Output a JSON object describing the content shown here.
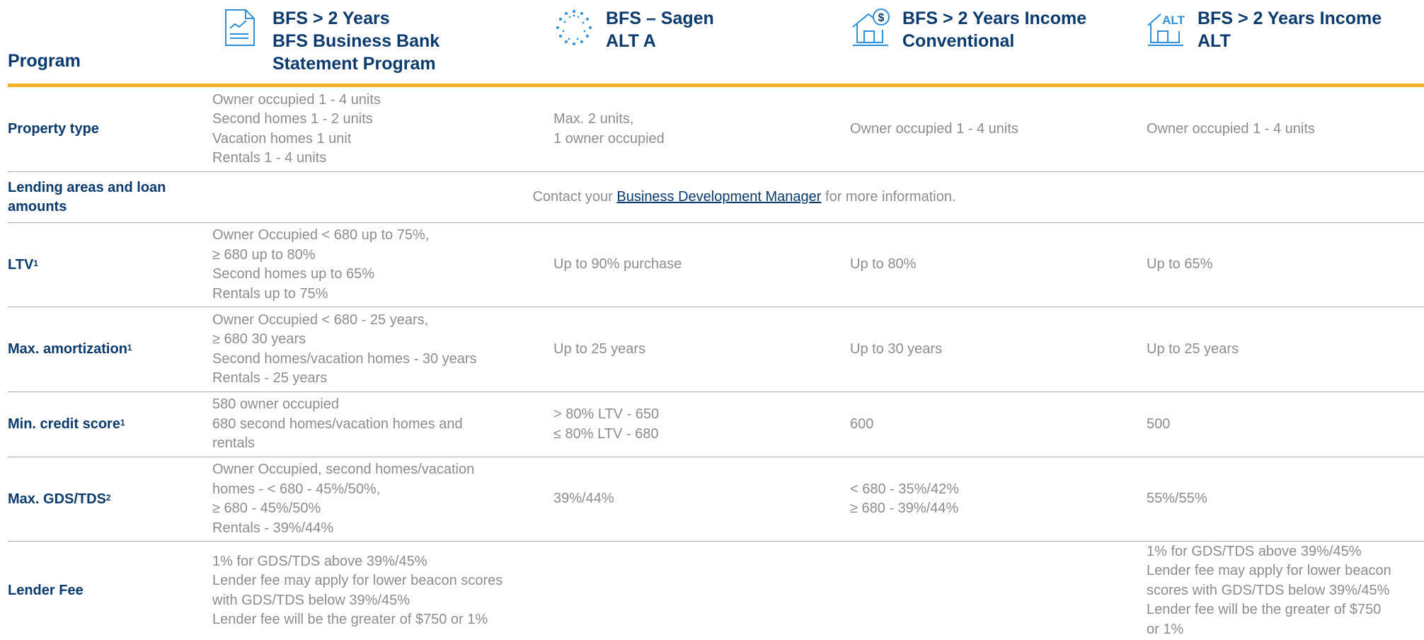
{
  "header": {
    "program_label": "Program",
    "columns": [
      {
        "icon": "bank-statement-icon",
        "title_lines": [
          "BFS > 2 Years",
          "BFS Business Bank",
          "Statement Program"
        ]
      },
      {
        "icon": "dotted-circle-logo-icon",
        "title_lines": [
          "BFS – Sagen",
          "ALT A"
        ]
      },
      {
        "icon": "house-dollar-icon",
        "title_lines": [
          "BFS > 2 Years Income",
          "Conventional"
        ]
      },
      {
        "icon": "house-alt-icon",
        "icon_text": "ALT",
        "title_lines": [
          "BFS > 2 Years Income",
          "ALT"
        ]
      }
    ]
  },
  "colors": {
    "navy": "#0b3a6e",
    "gold": "#f2b023",
    "text": "#8a8d91",
    "rule": "#a9acaf",
    "icon_blue": "#2f8fd8"
  },
  "rows": [
    {
      "label": "Property type",
      "sup": "",
      "cells": [
        [
          "Owner occupied 1 - 4 units",
          "Second homes 1 - 2 units",
          "Vacation homes 1 unit",
          "Rentals 1 - 4 units"
        ],
        [
          "Max. 2 units,",
          "1 owner occupied"
        ],
        [
          "Owner occupied 1 - 4 units"
        ],
        [
          "Owner occupied 1 - 4 units"
        ]
      ]
    },
    {
      "label": "Lending areas and loan amounts",
      "sup": "",
      "span": {
        "before": "Contact your ",
        "link": "Business Development Manager",
        "after": " for more information."
      }
    },
    {
      "label": "LTV",
      "sup": "1",
      "cells": [
        [
          "Owner Occupied < 680 up to 75%,",
          "≥ 680 up to 80%",
          "Second homes up to 65%",
          "Rentals up to 75%"
        ],
        [
          "Up to 90% purchase"
        ],
        [
          "Up to 80%"
        ],
        [
          "Up to 65%"
        ]
      ]
    },
    {
      "label": "Max. amortization",
      "sup": "1",
      "cells": [
        [
          "Owner Occupied < 680 - 25 years,",
          "≥ 680 30 years",
          "Second homes/vacation homes - 30 years",
          "Rentals - 25 years"
        ],
        [
          "Up to 25 years"
        ],
        [
          "Up to 30 years"
        ],
        [
          "Up to 25 years"
        ]
      ]
    },
    {
      "label": "Min. credit score",
      "sup": "1",
      "cells": [
        [
          "580 owner occupied",
          "680 second homes/vacation homes and",
          "rentals"
        ],
        [
          "> 80% LTV - 650",
          "≤ 80% LTV - 680"
        ],
        [
          "600"
        ],
        [
          "500"
        ]
      ]
    },
    {
      "label": "Max. GDS/TDS",
      "sup": "2",
      "cells": [
        [
          "Owner Occupied, second homes/vacation",
          "homes - < 680 - 45%/50%,",
          "≥ 680 - 45%/50%",
          "Rentals - 39%/44%"
        ],
        [
          "39%/44%"
        ],
        [
          "< 680 - 35%/42%",
          "≥ 680 - 39%/44%"
        ],
        [
          "55%/55%"
        ]
      ]
    },
    {
      "label": "Lender Fee",
      "sup": "",
      "cells": [
        [
          "1% for GDS/TDS above 39%/45%",
          "Lender fee may apply for lower beacon scores",
          "with GDS/TDS below 39%/45%",
          "Lender fee will be the greater of $750 or 1%"
        ],
        [],
        [],
        [
          "1% for GDS/TDS above 39%/45%",
          "Lender fee may apply for lower beacon",
          "scores with GDS/TDS below 39%/45%",
          "Lender fee will be the greater of $750",
          "or 1%"
        ]
      ]
    }
  ]
}
